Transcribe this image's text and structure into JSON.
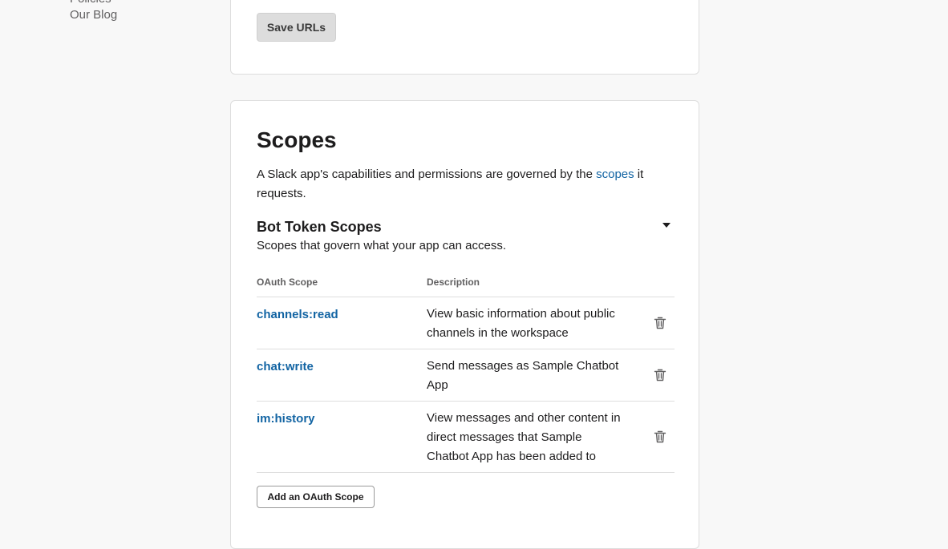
{
  "sidebar": {
    "items": [
      {
        "label": "Policies",
        "icon": ""
      },
      {
        "label": "Our Blog",
        "icon": ""
      }
    ]
  },
  "redirect_card": {
    "save_label": "Save URLs"
  },
  "scopes_card": {
    "title": "Scopes",
    "intro_before": "A Slack app's capabilities and permissions are governed by the ",
    "intro_link": "scopes",
    "intro_after": " it requests.",
    "bot_section": {
      "title": "Bot Token Scopes",
      "subtitle": "Scopes that govern what your app can access.",
      "columns": [
        "OAuth Scope",
        "Description"
      ],
      "rows": [
        {
          "scope": "channels:read",
          "description": "View basic information about public channels in the workspace",
          "icon": "trash-icon"
        },
        {
          "scope": "chat:write",
          "description": "Send messages as Sample Chatbot App",
          "icon": "trash-icon"
        },
        {
          "scope": "im:history",
          "description": "View messages and other content in direct messages that Sample Chatbot App has been added to",
          "icon": "trash-icon"
        }
      ],
      "add_label": "Add an OAuth Scope"
    }
  },
  "colors": {
    "link": "#1264a3",
    "background": "#f8f8f8",
    "border": "#dddddd"
  }
}
